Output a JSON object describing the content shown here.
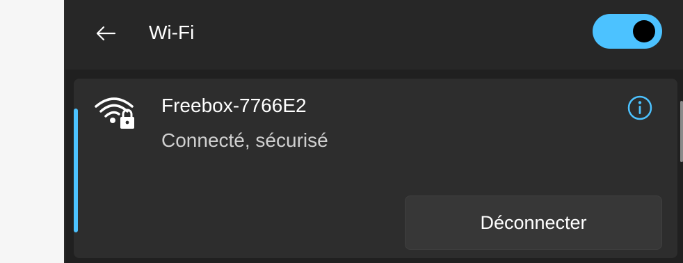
{
  "header": {
    "title": "Wi-Fi",
    "back_icon": "arrow-left-icon",
    "toggle_state": "on"
  },
  "network": {
    "name": "Freebox-7766E2",
    "status": "Connecté, sécurisé",
    "icon": "wifi-secured-icon",
    "info_icon": "info-icon",
    "disconnect_label": "Déconnecter"
  },
  "colors": {
    "accent": "#4cc2ff",
    "panel_bg": "#202020",
    "header_bg": "#272727",
    "card_bg": "#2d2d2d",
    "button_bg": "#373737"
  }
}
